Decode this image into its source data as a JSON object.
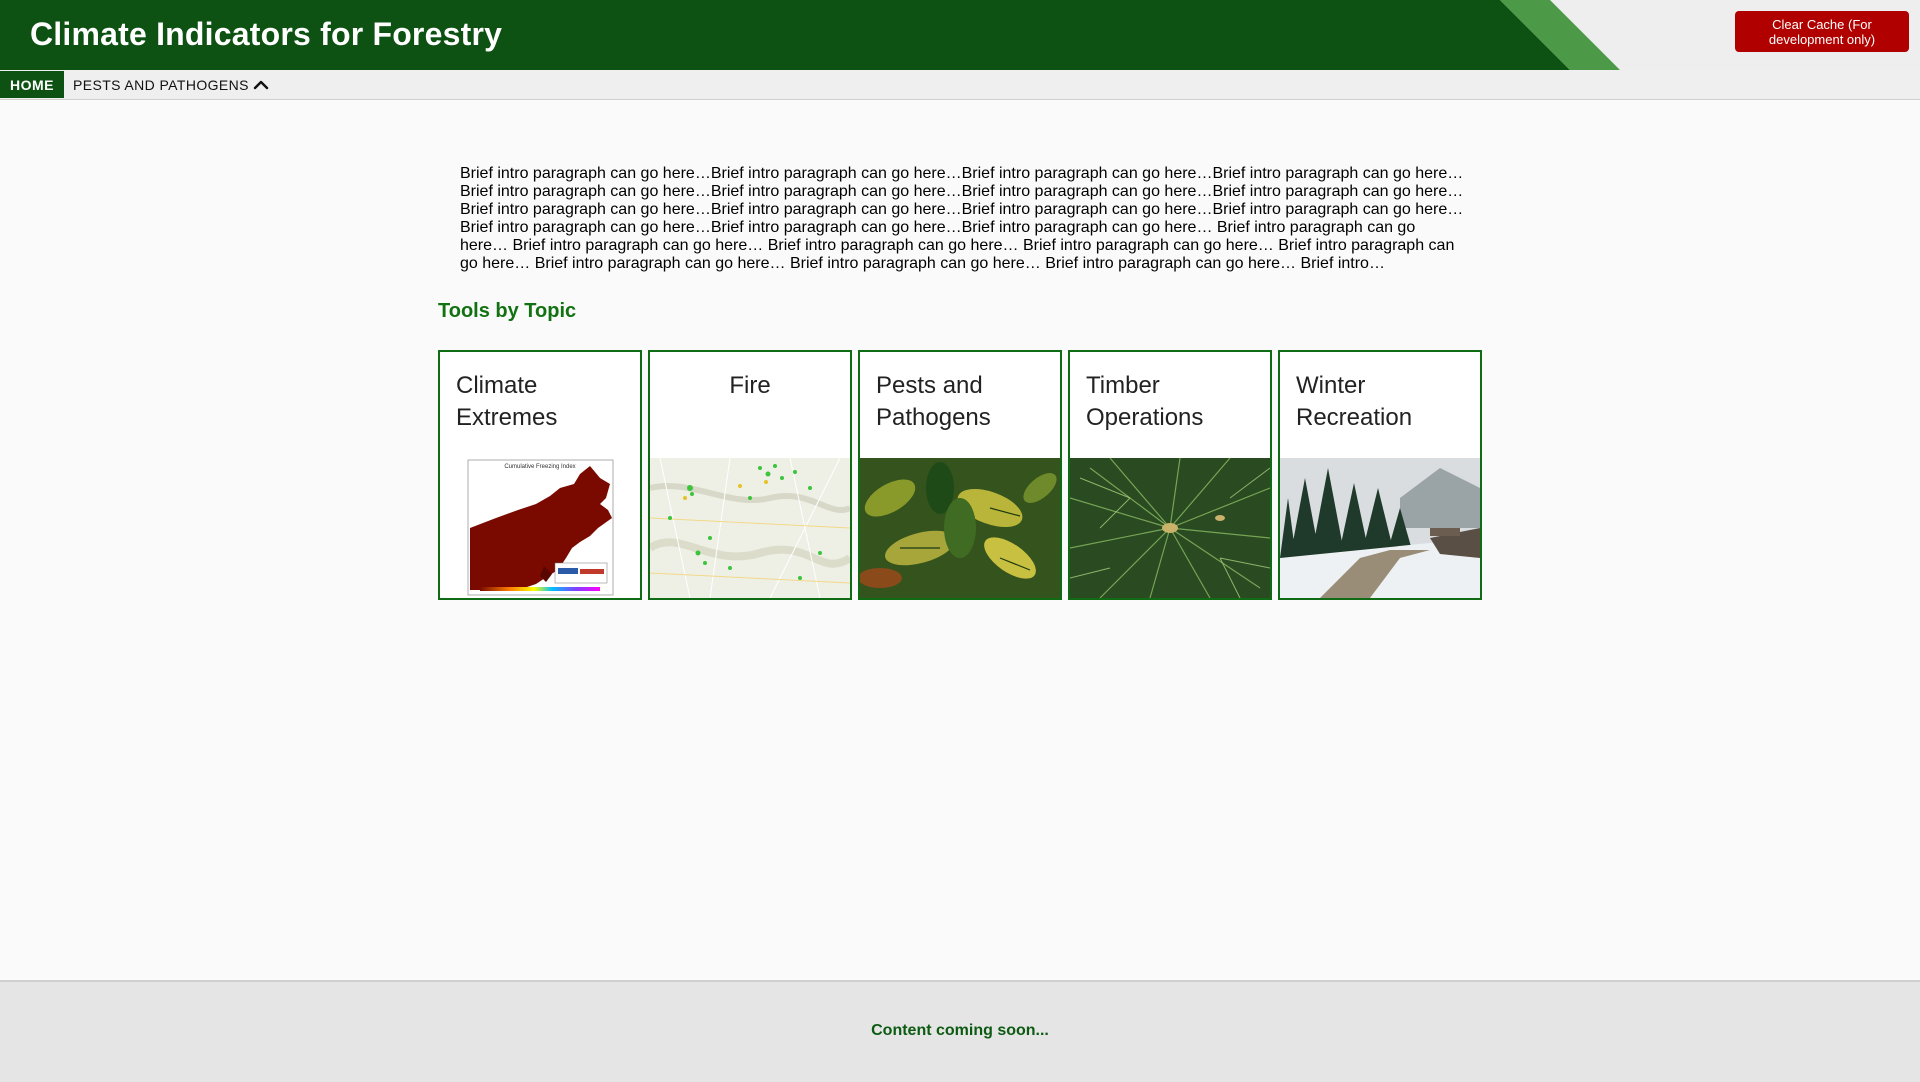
{
  "header": {
    "title": "Climate Indicators for Forestry",
    "clear_cache_label": "Clear Cache (For development only)",
    "brand_color": "#0d5212",
    "accent_color": "#4c9a48"
  },
  "nav": {
    "home_label": "HOME",
    "pests_label": "PESTS AND PATHOGENS",
    "pests_icon": "chevron-up-icon"
  },
  "intro": {
    "text": "Brief intro paragraph can go here…Brief intro paragraph can go here…Brief intro paragraph can go here…Brief intro paragraph can go here…Brief intro paragraph can go here…Brief intro paragraph can go here…Brief intro paragraph can go here…Brief intro paragraph can go here…Brief intro paragraph can go here…Brief intro paragraph can go here…Brief intro paragraph can go here…Brief intro paragraph can go here…Brief intro paragraph can go here…Brief intro paragraph can go here…Brief intro paragraph can go here… Brief intro paragraph can go here… Brief intro paragraph can go here… Brief intro paragraph can go here… Brief intro paragraph can go here… Brief intro paragraph can go here… Brief intro paragraph can go here… Brief intro paragraph can go here… Brief intro paragraph can go here… Brief intro…"
  },
  "tools": {
    "section_title": "Tools by Topic",
    "cards": [
      {
        "title": "Climate Extremes",
        "image": "cumulative-freezing-index-map"
      },
      {
        "title": "Fire",
        "image": "fire-weather-station-map"
      },
      {
        "title": "Pests and Pathogens",
        "image": "beech-leaves-photo"
      },
      {
        "title": "Timber Operations",
        "image": "pine-needles-photo"
      },
      {
        "title": "Winter Recreation",
        "image": "snowy-forest-road-photo"
      }
    ],
    "map_caption": "Cumulative Freezing Index"
  },
  "footer": {
    "text": "Content coming soon..."
  }
}
